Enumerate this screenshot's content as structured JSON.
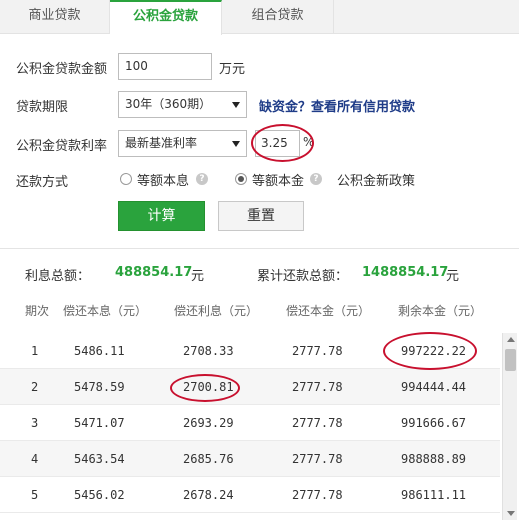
{
  "tabs": [
    "商业贷款",
    "公积金贷款",
    "组合贷款"
  ],
  "form": {
    "amount_label": "公积金贷款金额",
    "amount_value": "100",
    "amount_unit": "万元",
    "term_label": "贷款期限",
    "term_value": "30年（360期）",
    "term_link": "缺资金？查看所有信用贷款",
    "rate_label": "公积金贷款利率",
    "rate_option": "最新基准利率",
    "rate_value": "3.25",
    "rate_unit": "%",
    "method_label": "还款方式",
    "method_option1": "等额本息",
    "method_option2": "等额本金",
    "policy_link": "公积金新政策",
    "calc_button": "计算",
    "reset_button": "重置"
  },
  "summary": {
    "interest_label": "利息总额：",
    "interest_value": "488854.17",
    "interest_unit": "元",
    "total_label": "累计还款总额：",
    "total_value": "1488854.17",
    "total_unit": "元"
  },
  "table": {
    "headers": [
      "期次",
      "偿还本息（元）",
      "偿还利息（元）",
      "偿还本金（元）",
      "剩余本金（元）"
    ],
    "rows": [
      [
        "1",
        "5486.11",
        "2708.33",
        "2777.78",
        "997222.22"
      ],
      [
        "2",
        "5478.59",
        "2700.81",
        "2777.78",
        "994444.44"
      ],
      [
        "3",
        "5471.07",
        "2693.29",
        "2777.78",
        "991666.67"
      ],
      [
        "4",
        "5463.54",
        "2685.76",
        "2777.78",
        "988888.89"
      ],
      [
        "5",
        "5456.02",
        "2678.24",
        "2777.78",
        "986111.11"
      ]
    ]
  },
  "icons": {
    "help": "question-icon",
    "dropdown": "chevron-down-icon"
  },
  "colors": {
    "accent": "#2aa33d",
    "link": "#1f3c88",
    "annotation": "#c8102e"
  }
}
